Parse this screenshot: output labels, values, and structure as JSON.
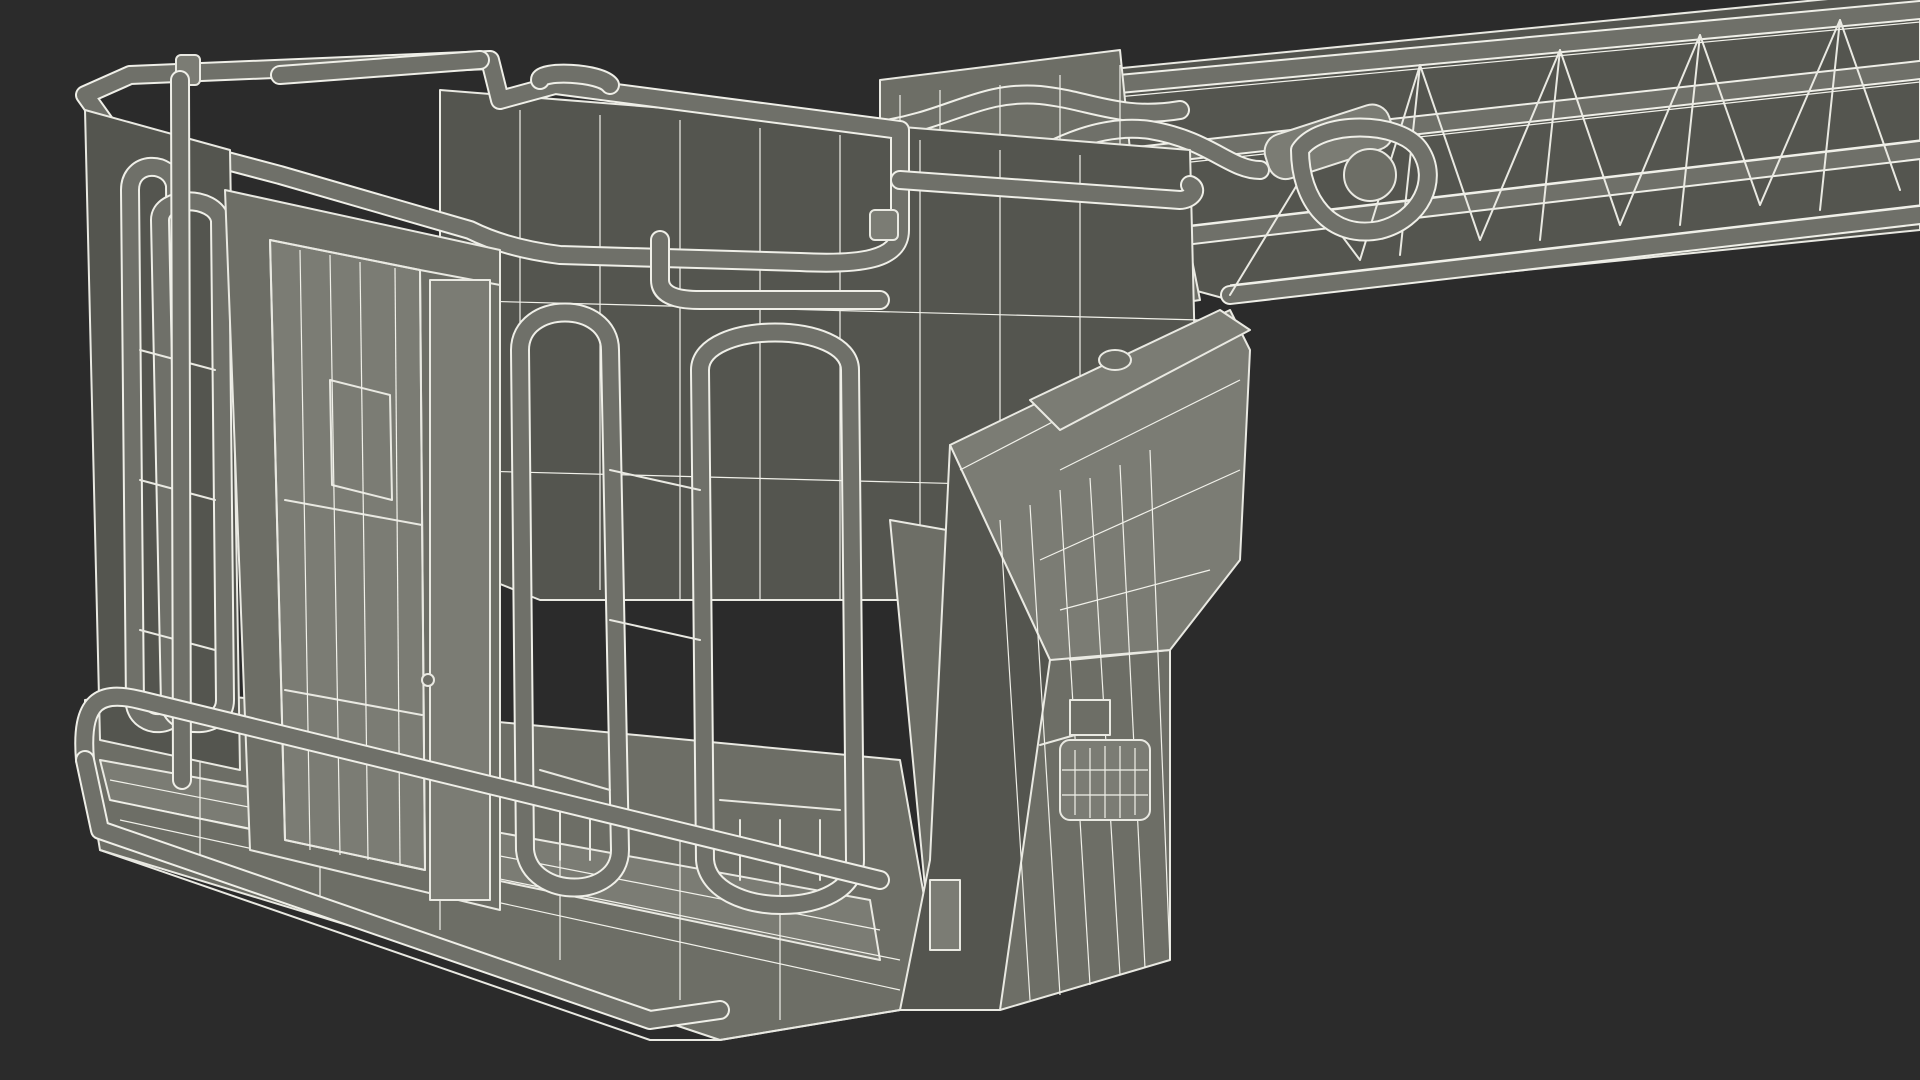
{
  "scene": {
    "subject": "wireframe-render",
    "background_color": "#2b2b2b",
    "model_fill_color": "#6d6e66",
    "wire_color": "#e9e9e2"
  }
}
